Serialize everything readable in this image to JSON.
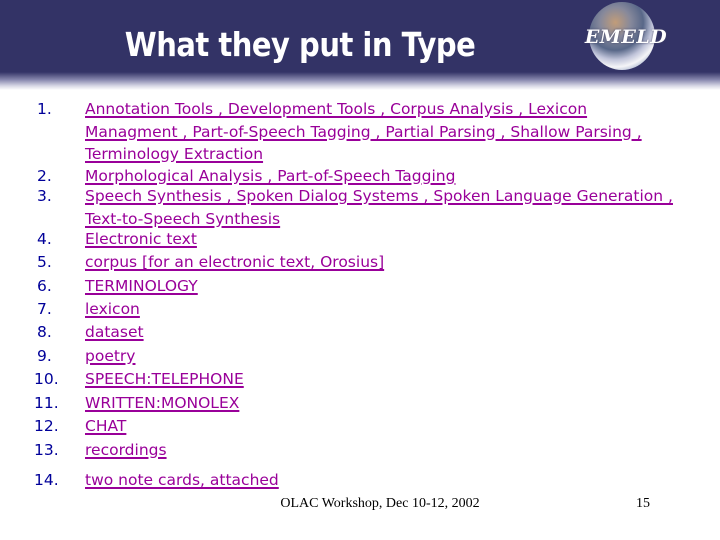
{
  "header": {
    "title": "What they put in Type",
    "logo_text": "EMELD"
  },
  "list": {
    "items": [
      {
        "number": "1.",
        "text": "Annotation Tools , Development Tools , Corpus Analysis , Lexicon Managment , Part-of-Speech Tagging , Partial Parsing , Shallow Parsing , Terminology Extraction"
      },
      {
        "number": "2.",
        "text": "Morphological Analysis , Part-of-Speech Tagging"
      },
      {
        "number": "3.",
        "text": "Speech Synthesis , Spoken Dialog Systems , Spoken Language Generation , Text-to-Speech Synthesis"
      },
      {
        "number": "4.",
        "text": "Electronic text"
      },
      {
        "number": "5.",
        "text": "corpus [for an electronic text, Orosius]"
      },
      {
        "number": "6.",
        "text": "TERMINOLOGY"
      },
      {
        "number": "7.",
        "text": "lexicon"
      },
      {
        "number": "8.",
        "text": "dataset"
      },
      {
        "number": "9.",
        "text": "poetry"
      },
      {
        "number": "10.",
        "text": "SPEECH:TELEPHONE"
      },
      {
        "number": "11.",
        "text": "WRITTEN:MONOLEX"
      },
      {
        "number": "12.",
        "text": "CHAT"
      },
      {
        "number": "13.",
        "text": "recordings"
      },
      {
        "number": "14.",
        "text": "two note cards, attached"
      }
    ]
  },
  "footer": {
    "text": "OLAC Workshop, Dec 10-12, 2002",
    "page_number": "15"
  },
  "colors": {
    "header_bg": "#333366",
    "number_color": "#000099",
    "link_color": "#990099"
  }
}
